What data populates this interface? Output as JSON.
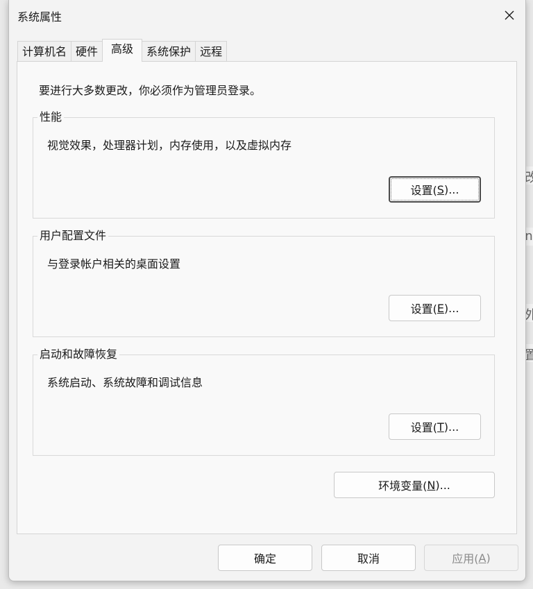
{
  "window": {
    "title": "系统属性"
  },
  "tabs": [
    {
      "label": "计算机名",
      "active": false
    },
    {
      "label": "硬件",
      "active": false
    },
    {
      "label": "高级",
      "active": true
    },
    {
      "label": "系统保护",
      "active": false
    },
    {
      "label": "远程",
      "active": false
    }
  ],
  "admin_note": "要进行大多数更改，你必须作为管理员登录。",
  "groups": {
    "performance": {
      "title": "性能",
      "description": "视觉效果，处理器计划，内存使用，以及虚拟内存",
      "button_prefix": "设置(",
      "button_key": "S",
      "button_suffix": ")..."
    },
    "profile": {
      "title": "用户配置文件",
      "description": "与登录帐户相关的桌面设置",
      "button_prefix": "设置(",
      "button_key": "E",
      "button_suffix": ")..."
    },
    "startup": {
      "title": "启动和故障恢复",
      "description": "系统启动、系统故障和调试信息",
      "button_prefix": "设置(",
      "button_key": "T",
      "button_suffix": ")..."
    }
  },
  "env_button": {
    "prefix": "环境变量(",
    "key": "N",
    "suffix": ")..."
  },
  "footer": {
    "ok": "确定",
    "cancel": "取消",
    "apply_prefix": "应用(",
    "apply_key": "A",
    "apply_suffix": ")"
  },
  "background_glyphs": [
    "改",
    "n",
    "外",
    "置"
  ],
  "colors": {
    "window_bg": "#f3f3f3",
    "content_bg": "#f9f9f9",
    "border": "#d4d4d4",
    "disabled_text": "#8a8a8a"
  }
}
